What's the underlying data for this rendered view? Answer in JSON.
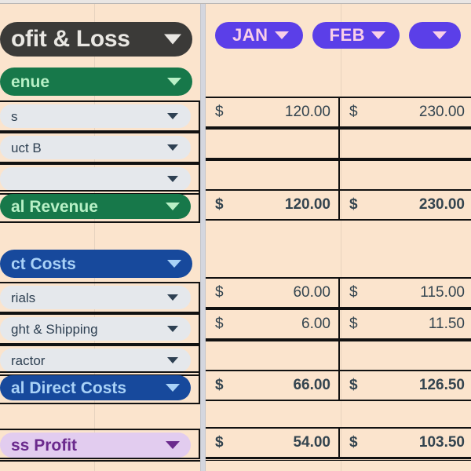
{
  "document": {
    "title": "Profit & Loss",
    "title_full_visible": "ofit & Loss"
  },
  "months": [
    {
      "label": "JAN",
      "caret": "chevron-down-icon"
    },
    {
      "label": "FEB",
      "caret": "chevron-down-icon"
    }
  ],
  "colors": {
    "sheet_background": "#fbe4cd",
    "title_pill": "#3b3a38",
    "title_text": "#e9e7e3",
    "revenue_header": "#17784a",
    "revenue_header_text": "#b8f0c6",
    "costs_header": "#17499c",
    "costs_header_text": "#a9d2f7",
    "gross_profit_pill": "#e2ccef",
    "gross_profit_text": "#6b2a8d",
    "month_pill": "#5b3fe8",
    "month_text": "#f9cfe8",
    "line_item_pill": "#e5e8ec",
    "line_item_text": "#2e4052",
    "value_text": "#33444f",
    "grid_line": "#111111"
  },
  "rows": {
    "revenue_header": {
      "label": "enue",
      "full": "Revenue"
    },
    "revenue_items": [
      {
        "label": "s",
        "full": "Sales",
        "jan": "120.00",
        "feb": "230.00",
        "currency": "$"
      },
      {
        "label": "uct B",
        "full": "Product B",
        "jan": "",
        "feb": "",
        "currency": ""
      },
      {
        "label": "",
        "full": "",
        "jan": "",
        "feb": "",
        "currency": ""
      }
    ],
    "revenue_total": {
      "label": "al Revenue",
      "full": "Total Revenue",
      "jan": "120.00",
      "feb": "230.00",
      "currency": "$"
    },
    "costs_header": {
      "label": "ct Costs",
      "full": "Direct Costs"
    },
    "cost_items": [
      {
        "label": "rials",
        "full": "Materials",
        "jan": "60.00",
        "feb": "115.00",
        "currency": "$"
      },
      {
        "label": "ght & Shipping",
        "full": "Freight & Shipping",
        "jan": "6.00",
        "feb": "11.50",
        "currency": "$"
      },
      {
        "label": "ractor",
        "full": "Contractor",
        "jan": "",
        "feb": "",
        "currency": ""
      }
    ],
    "costs_total": {
      "label": "al Direct Costs",
      "full": "Total Direct Costs",
      "jan": "66.00",
      "feb": "126.50",
      "currency": "$"
    },
    "gross_profit": {
      "label": "ss Profit",
      "full": "Gross Profit",
      "jan": "54.00",
      "feb": "103.50",
      "currency": "$"
    }
  },
  "icons": {
    "dropdown": "chevron-down-icon"
  }
}
